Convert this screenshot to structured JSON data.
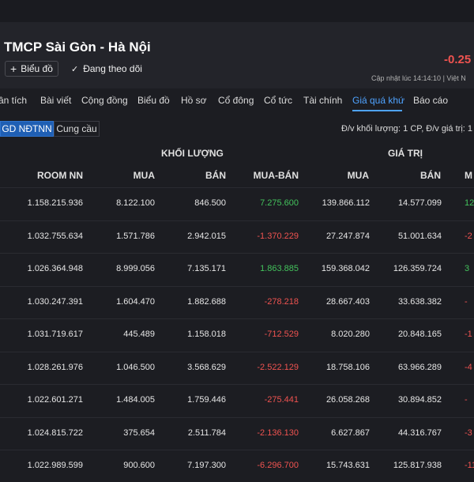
{
  "header": {
    "title": "TMCP Sài Gòn - Hà Nội",
    "chart_button": "Biểu đồ",
    "follow_button": "Đang theo dõi",
    "price_change": "-0.25",
    "update_text": "Cập nhật lúc  14:14:10 | Việt N"
  },
  "tabs": [
    "ân tích",
    "Bài viết",
    "Cộng đồng",
    "Biểu đồ",
    "Hồ sơ",
    "Cổ đông",
    "Cổ tức",
    "Tài chính",
    "Giá quá khứ",
    "Báo cáo"
  ],
  "active_tab": "Giá quá khứ",
  "subtabs": {
    "active": "GD NĐTNN",
    "other": "Cung cầu"
  },
  "unit_note": "Đ/v khối lượng: 1 CP, Đ/v giá trị: 1",
  "groups": {
    "volume": "KHỐI LƯỢNG",
    "value": "GIÁ TRỊ"
  },
  "columns": {
    "room": "ROOM NN",
    "buy_vol": "MUA",
    "sell_vol": "BÁN",
    "net_vol": "MUA-BÁN",
    "buy_val": "MUA",
    "sell_val": "BÁN",
    "net_val": "M"
  },
  "rows": [
    {
      "room": "1.158.215.936",
      "buy_vol": "8.122.100",
      "sell_vol": "846.500",
      "net_vol": "7.275.600",
      "buy_val": "139.866.112",
      "sell_val": "14.577.099",
      "net_val": "12"
    },
    {
      "room": "1.032.755.634",
      "buy_vol": "1.571.786",
      "sell_vol": "2.942.015",
      "net_vol": "-1.370.229",
      "buy_val": "27.247.874",
      "sell_val": "51.001.634",
      "net_val": "-2"
    },
    {
      "room": "1.026.364.948",
      "buy_vol": "8.999.056",
      "sell_vol": "7.135.171",
      "net_vol": "1.863.885",
      "buy_val": "159.368.042",
      "sell_val": "126.359.724",
      "net_val": "3"
    },
    {
      "room": "1.030.247.391",
      "buy_vol": "1.604.470",
      "sell_vol": "1.882.688",
      "net_vol": "-278.218",
      "buy_val": "28.667.403",
      "sell_val": "33.638.382",
      "net_val": "-"
    },
    {
      "room": "1.031.719.617",
      "buy_vol": "445.489",
      "sell_vol": "1.158.018",
      "net_vol": "-712.529",
      "buy_val": "8.020.280",
      "sell_val": "20.848.165",
      "net_val": "-1"
    },
    {
      "room": "1.028.261.976",
      "buy_vol": "1.046.500",
      "sell_vol": "3.568.629",
      "net_vol": "-2.522.129",
      "buy_val": "18.758.106",
      "sell_val": "63.966.289",
      "net_val": "-4"
    },
    {
      "room": "1.022.601.271",
      "buy_vol": "1.484.005",
      "sell_vol": "1.759.446",
      "net_vol": "-275.441",
      "buy_val": "26.058.268",
      "sell_val": "30.894.852",
      "net_val": "-"
    },
    {
      "room": "1.024.815.722",
      "buy_vol": "375.654",
      "sell_vol": "2.511.784",
      "net_vol": "-2.136.130",
      "buy_val": "6.627.867",
      "sell_val": "44.316.767",
      "net_val": "-3"
    },
    {
      "room": "1.022.989.599",
      "buy_vol": "900.600",
      "sell_vol": "7.197.300",
      "net_vol": "-6.296.700",
      "buy_val": "15.743.631",
      "sell_val": "125.817.938",
      "net_val": "-11"
    }
  ],
  "colors": {
    "positive": "#26a69a",
    "negative": "#ef5350",
    "accent": "#4fa3ff",
    "active_subtab": "#1f5fb4"
  }
}
